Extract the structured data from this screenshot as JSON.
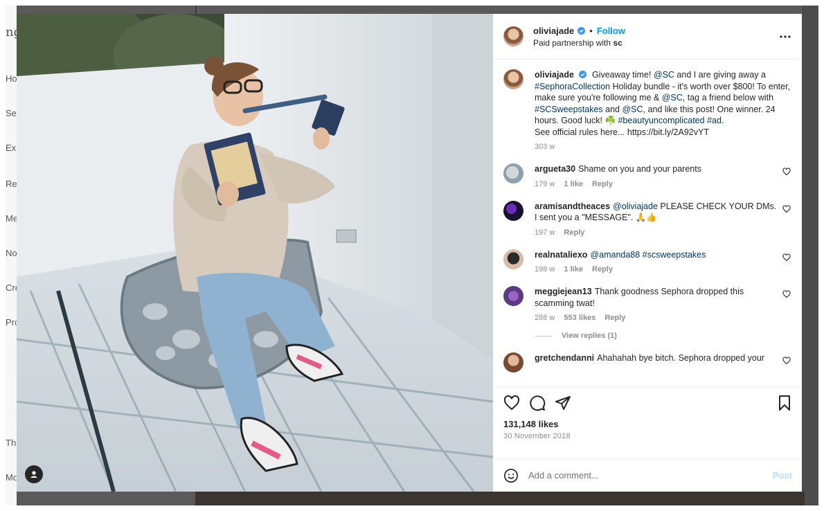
{
  "background": {
    "left_fragments": [
      "ng",
      "Ho",
      "Se",
      "Exp",
      "Re",
      "Me",
      "No",
      "Cre",
      "Pro",
      "Th",
      "Mo"
    ]
  },
  "post": {
    "author": "oliviajade",
    "follow_label": "Follow",
    "dot": "•",
    "partnership_prefix": "Paid partnership with",
    "partner": "sc",
    "caption": {
      "user": "oliviajade",
      "segments": [
        {
          "t": "Giveaway time! ",
          "tag": false
        },
        {
          "t": "@SC",
          "tag": true
        },
        {
          "t": " and I are giving away a ",
          "tag": false
        },
        {
          "t": "#SephoraCollection",
          "tag": true
        },
        {
          "t": " Holiday bundle - it's worth over $800! To enter, make sure you're following me & ",
          "tag": false
        },
        {
          "t": "@SC",
          "tag": true
        },
        {
          "t": ", tag a friend below with ",
          "tag": false
        },
        {
          "t": "#SCSweepstakes",
          "tag": true
        },
        {
          "t": " and ",
          "tag": false
        },
        {
          "t": "@SC",
          "tag": true
        },
        {
          "t": ", and like this post! One winner. 24 hours. Good luck! ☘️ ",
          "tag": false
        },
        {
          "t": "#beautyuncomplicated",
          "tag": true
        },
        {
          "t": " ",
          "tag": false
        },
        {
          "t": "#ad",
          "tag": true
        },
        {
          "t": ".",
          "tag": false
        }
      ],
      "rules_line": "See official rules here... https://bit.ly/2A92vYT",
      "age": "303 w"
    },
    "comments": [
      {
        "user": "argueta30",
        "text": "Shame on you and your parents",
        "time": "179 w",
        "likes": "1 like",
        "reply": "Reply"
      },
      {
        "user": "aramisandtheaces",
        "mention": "@oliviajade",
        "text": " PLEASE CHECK YOUR DMs. I sent you a \"MESSAGE\". 🙏👍",
        "time": "197 w",
        "reply": "Reply"
      },
      {
        "user": "realnataliexo",
        "mention": "@amanda88 #scsweepstakes",
        "text": "",
        "time": "198 w",
        "likes": "1 like",
        "reply": "Reply"
      },
      {
        "user": "meggiejean13",
        "text": "Thank goodness Sephora dropped this scamming twat!",
        "time": "288 w",
        "likes": "553 likes",
        "reply": "Reply",
        "view_replies": "View replies (1)"
      },
      {
        "user": "gretchendanni",
        "text": "Ahahahah bye bitch. Sephora dropped your"
      }
    ],
    "likes": "131,148 likes",
    "date": "30 November 2018",
    "comment_placeholder": "Add a comment...",
    "post_label": "Post"
  },
  "icons": {
    "verified": "verified-badge-icon",
    "more": "more-options-icon",
    "heart": "heart-icon",
    "comment": "comment-icon",
    "share": "share-icon",
    "bookmark": "bookmark-icon",
    "emoji": "emoji-icon",
    "user_tag": "user-tag-icon"
  },
  "colors": {
    "link_blue": "#0095f6",
    "tag_blue": "#00376b",
    "verified_blue": "#3897f0",
    "muted": "#8e8e8e"
  }
}
